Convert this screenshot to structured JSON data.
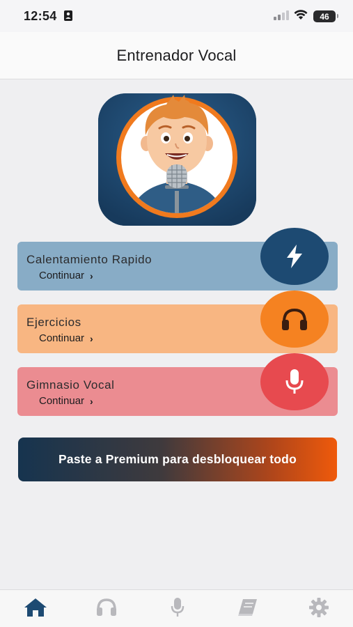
{
  "status_bar": {
    "time": "12:54",
    "battery": "46"
  },
  "header": {
    "title": "Entrenador Vocal"
  },
  "cards": [
    {
      "title": "Calentamiento Rapido",
      "action": "Continuar",
      "icon": "lightning-bolt-icon",
      "color": "#88acc6",
      "accent": "#1d4a72"
    },
    {
      "title": "Ejercicios",
      "action": "Continuar",
      "icon": "headphones-icon",
      "color": "#f8b682",
      "accent": "#f58221"
    },
    {
      "title": "Gimnasio Vocal",
      "action": "Continuar",
      "icon": "microphone-icon",
      "color": "#eb8c91",
      "accent": "#e74a4f"
    }
  ],
  "premium": {
    "label": "Paste a Premium para desbloquear todo"
  },
  "tab_bar": {
    "items": [
      {
        "icon": "home-icon",
        "active": true
      },
      {
        "icon": "headphones-icon",
        "active": false
      },
      {
        "icon": "microphone-icon",
        "active": false
      },
      {
        "icon": "book-icon",
        "active": false
      },
      {
        "icon": "gear-icon",
        "active": false
      }
    ],
    "active_color": "#1d4a72",
    "inactive_color": "#b8b8bc"
  }
}
